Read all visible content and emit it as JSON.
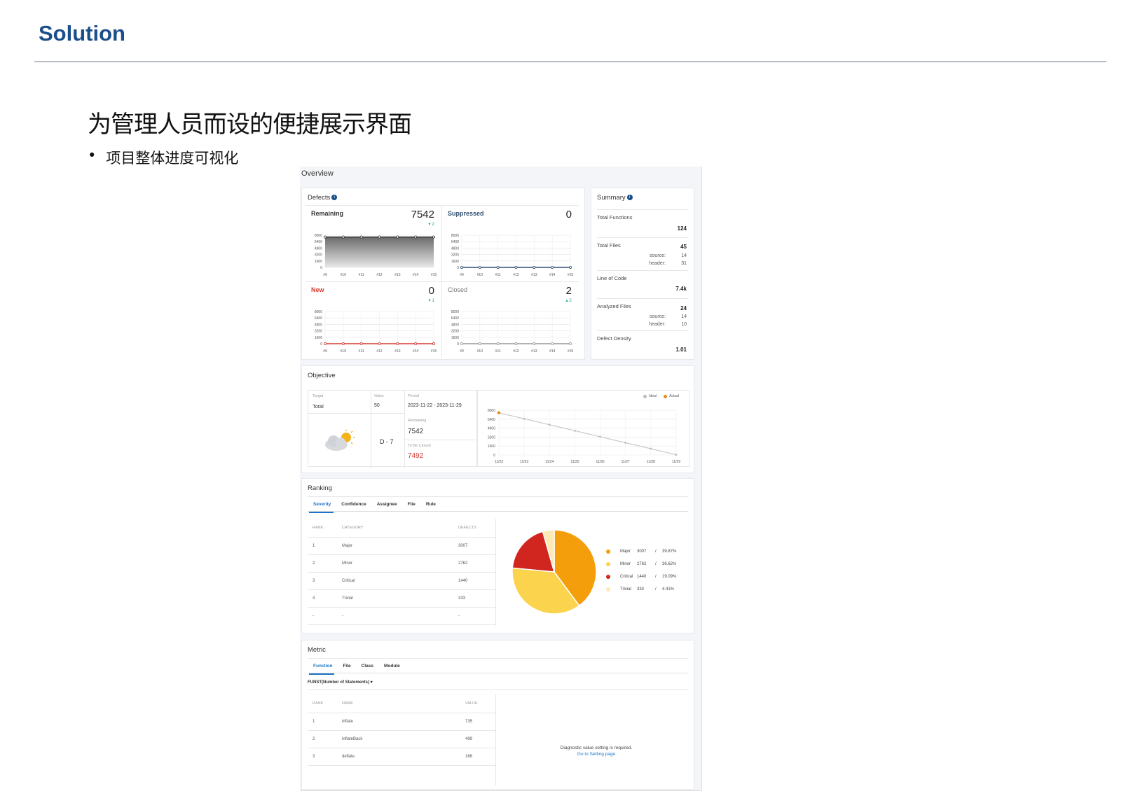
{
  "slide": {
    "title": "Solution",
    "heading": "为管理人员而设的便捷展示界面",
    "bullet_mark": "•",
    "bullet": "项目整体进度可视化"
  },
  "overview": {
    "title": "Overview",
    "defects": {
      "title": "Defects",
      "info_icon": "i",
      "remaining": {
        "label": "Remaining",
        "value": "7542",
        "delta": "▾ 2"
      },
      "suppressed": {
        "label": "Suppressed",
        "value": "0"
      },
      "new": {
        "label": "New",
        "value": "0",
        "delta": "▾ 1"
      },
      "closed": {
        "label": "Closed",
        "value": "2",
        "delta": "▴ 2"
      },
      "y_ticks": [
        "8000",
        "6400",
        "4800",
        "3200",
        "1600",
        "0"
      ],
      "x_ticks": [
        "#9",
        "#10",
        "#11",
        "#12",
        "#13",
        "#14",
        "#15"
      ]
    },
    "summary": {
      "title": "Summary",
      "info_icon": "i",
      "total_functions": {
        "label": "Total Functions",
        "value": "124"
      },
      "total_files": {
        "label": "Total Files",
        "value": "45",
        "source_label": "source:",
        "source": "14",
        "header_label": "header:",
        "header": "31"
      },
      "line_of_code": {
        "label": "Line of Code",
        "value": "7.4k"
      },
      "analyzed_files": {
        "label": "Analyzed Files",
        "value": "24",
        "source_label": "source:",
        "source": "14",
        "header_label": "header:",
        "header": "10"
      },
      "defect_density": {
        "label": "Defect Density",
        "value": "1.01"
      }
    }
  },
  "objective": {
    "title": "Objective",
    "target_label": "Target",
    "target_value": "Total",
    "value_label": "Value",
    "value": "50",
    "period_label": "Period",
    "period": "2023-11-22 - 2023-11-29",
    "d_day": "D - 7",
    "remaining_label": "Remaining",
    "remaining": "7542",
    "to_be_closed_label": "To Be Closed",
    "to_be_closed": "7492",
    "legend_ideal": "Ideal",
    "legend_actual": "Actual",
    "y_ticks": [
      "8000",
      "6400",
      "4800",
      "3200",
      "1600",
      "0"
    ],
    "x_ticks": [
      "11/22",
      "11/23",
      "11/24",
      "11/25",
      "11/26",
      "11/27",
      "11/28",
      "11/29"
    ]
  },
  "ranking": {
    "title": "Ranking",
    "tabs": [
      "Severity",
      "Confidence",
      "Assignee",
      "File",
      "Rule"
    ],
    "columns": [
      "RANK",
      "CATEGORY",
      "DEFECTS"
    ],
    "rows": [
      [
        "1",
        "Major",
        "3007"
      ],
      [
        "2",
        "Minor",
        "2762"
      ],
      [
        "3",
        "Critical",
        "1440"
      ],
      [
        "4",
        "Trivial",
        "333"
      ],
      [
        "-",
        "-",
        "-"
      ]
    ],
    "legend": [
      {
        "name": "Major",
        "count": "3007",
        "sep": "/",
        "pct": "39.87%"
      },
      {
        "name": "Minor",
        "count": "2762",
        "sep": "/",
        "pct": "36.62%"
      },
      {
        "name": "Critical",
        "count": "1440",
        "sep": "/",
        "pct": "19.09%"
      },
      {
        "name": "Trivial",
        "count": "333",
        "sep": "/",
        "pct": "4.41%"
      }
    ]
  },
  "metric": {
    "title": "Metric",
    "tabs": [
      "Function",
      "File",
      "Class",
      "Module"
    ],
    "dropdown": "FUNST(Number of Statements) ▾",
    "columns": [
      "RANK",
      "NAME",
      "VALUE"
    ],
    "rows": [
      [
        "1",
        "inflate",
        "735"
      ],
      [
        "2",
        "inflateBack",
        "499"
      ],
      [
        "3",
        "deflate",
        "168"
      ]
    ],
    "diagnostic_msg": "Diagnostic value setting is required.",
    "setting_link": "Go to Setting page"
  },
  "colors": {
    "brand": "#1b4f8a",
    "major": "#f59e0b",
    "minor": "#fcd34d",
    "critical": "#d1261f",
    "trivial": "#fde9b4",
    "new_line": "#d33a32",
    "suppressed_line": "#2f4f6f"
  },
  "chart_data": [
    {
      "type": "area",
      "title": "Remaining",
      "categories": [
        "#9",
        "#10",
        "#11",
        "#12",
        "#13",
        "#14",
        "#15"
      ],
      "values": [
        7542,
        7542,
        7542,
        7542,
        7542,
        7542,
        7542
      ],
      "ylim": [
        0,
        8000
      ]
    },
    {
      "type": "line",
      "title": "Suppressed",
      "categories": [
        "#9",
        "#10",
        "#11",
        "#12",
        "#13",
        "#14",
        "#15"
      ],
      "values": [
        0,
        0,
        0,
        0,
        0,
        0,
        0
      ],
      "ylim": [
        0,
        8000
      ]
    },
    {
      "type": "line",
      "title": "New",
      "categories": [
        "#9",
        "#10",
        "#11",
        "#12",
        "#13",
        "#14",
        "#15"
      ],
      "values": [
        0,
        0,
        0,
        0,
        0,
        0,
        0
      ],
      "ylim": [
        0,
        8000
      ]
    },
    {
      "type": "line",
      "title": "Closed",
      "categories": [
        "#9",
        "#10",
        "#11",
        "#12",
        "#13",
        "#14",
        "#15"
      ],
      "values": [
        0,
        0,
        0,
        0,
        0,
        0,
        2
      ],
      "ylim": [
        0,
        8000
      ]
    },
    {
      "type": "line",
      "categories": [
        "11/22",
        "11/23",
        "11/24",
        "11/25",
        "11/26",
        "11/27",
        "11/28",
        "11/29"
      ],
      "series": [
        {
          "name": "Ideal",
          "values": [
            7542,
            6472,
            5402,
            4332,
            3262,
            2192,
            1122,
            50
          ]
        },
        {
          "name": "Actual",
          "values": [
            7542
          ]
        }
      ],
      "ylim": [
        0,
        8000
      ]
    },
    {
      "type": "pie",
      "categories": [
        "Major",
        "Minor",
        "Critical",
        "Trivial"
      ],
      "values": [
        3007,
        2762,
        1440,
        333
      ]
    }
  ]
}
